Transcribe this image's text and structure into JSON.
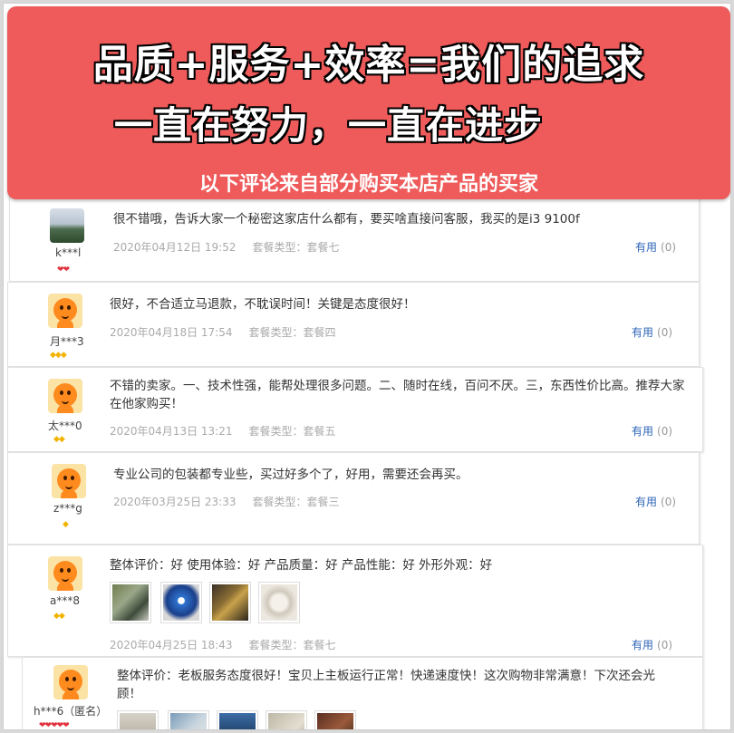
{
  "banner": {
    "line1": "品质+服务+效率=我们的追求",
    "line2": "一直在努力，一直在进步",
    "line3": "以下评论来自部分购买本店产品的买家"
  },
  "reviews": [
    {
      "user": "k***l",
      "badge": "❤❤",
      "text": "很不错哦，告诉大家一个秘密这家店什么都有，要买啥直接问客服，我买的是i3 9100f",
      "date": "2020年04月12日 19:52",
      "package": "套餐类型：套餐七",
      "helpful": "有用",
      "count": "(0)"
    },
    {
      "user": "月***3",
      "badge": "◆◆◆",
      "text": "很好，不合适立马退款，不耽误时间！关键是态度很好！",
      "date": "2020年04月18日 17:54",
      "package": "套餐类型：套餐四",
      "helpful": "有用",
      "count": "(0)"
    },
    {
      "user": "太***0",
      "badge": "◆◆",
      "text": "不错的卖家。一、技术性强，能帮处理很多问题。二、随时在线，百问不厌。三，东西性价比高。推荐大家在他家购买！",
      "date": "2020年04月13日 13:21",
      "package": "套餐类型：套餐五",
      "helpful": "有用",
      "count": "(0)"
    },
    {
      "user": "z***g",
      "badge": "◆",
      "text": "专业公司的包装都专业些，买过好多个了，好用，需要还会再买。",
      "date": "2020年03月25日 23:33",
      "package": "套餐类型：套餐三",
      "helpful": "有用",
      "count": "(0)"
    },
    {
      "user": "a***8",
      "badge": "◆◆",
      "text": "整体评价：好 使用体验：好 产品质量：好 产品性能：好 外形外观：好",
      "date": "2020年04月25日 18:43",
      "package": "套餐类型：套餐七",
      "helpful": "有用",
      "count": "(0)"
    },
    {
      "user": "h***6（匿名）",
      "badge": "❤❤❤❤❤",
      "text": "整体评价：老板服务态度很好！宝贝上主板运行正常！快递速度快！这次购物非常满意！下次还会光顾！"
    }
  ],
  "colors": {
    "banner": "#ef5b5b",
    "link": "#2d65b7"
  }
}
